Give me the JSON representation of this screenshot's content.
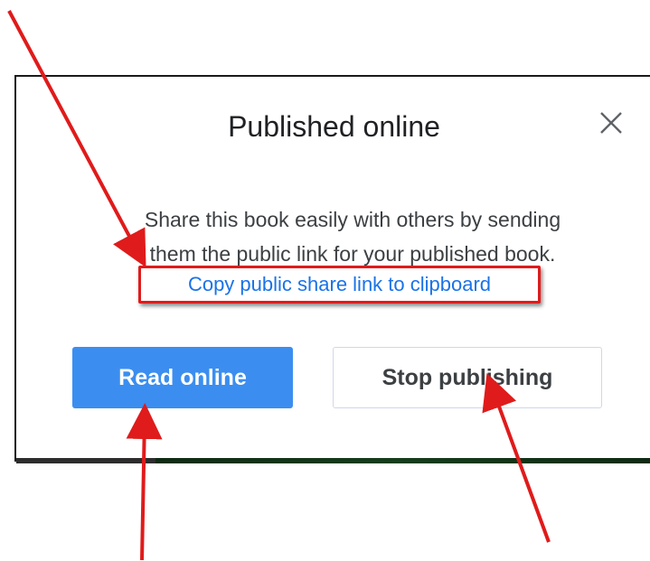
{
  "dialog": {
    "title": "Published online",
    "close_icon": "close-icon",
    "description_line1": "Share this book easily with others by sending",
    "description_line2": "them the public link for your published book.",
    "share_link_label": "Copy public share link to clipboard"
  },
  "buttons": {
    "read_online": "Read online",
    "stop_publishing": "Stop publishing"
  },
  "colors": {
    "primary_button": "#3b8ef0",
    "link": "#1a73e8",
    "annotation": "#e01b1b"
  }
}
